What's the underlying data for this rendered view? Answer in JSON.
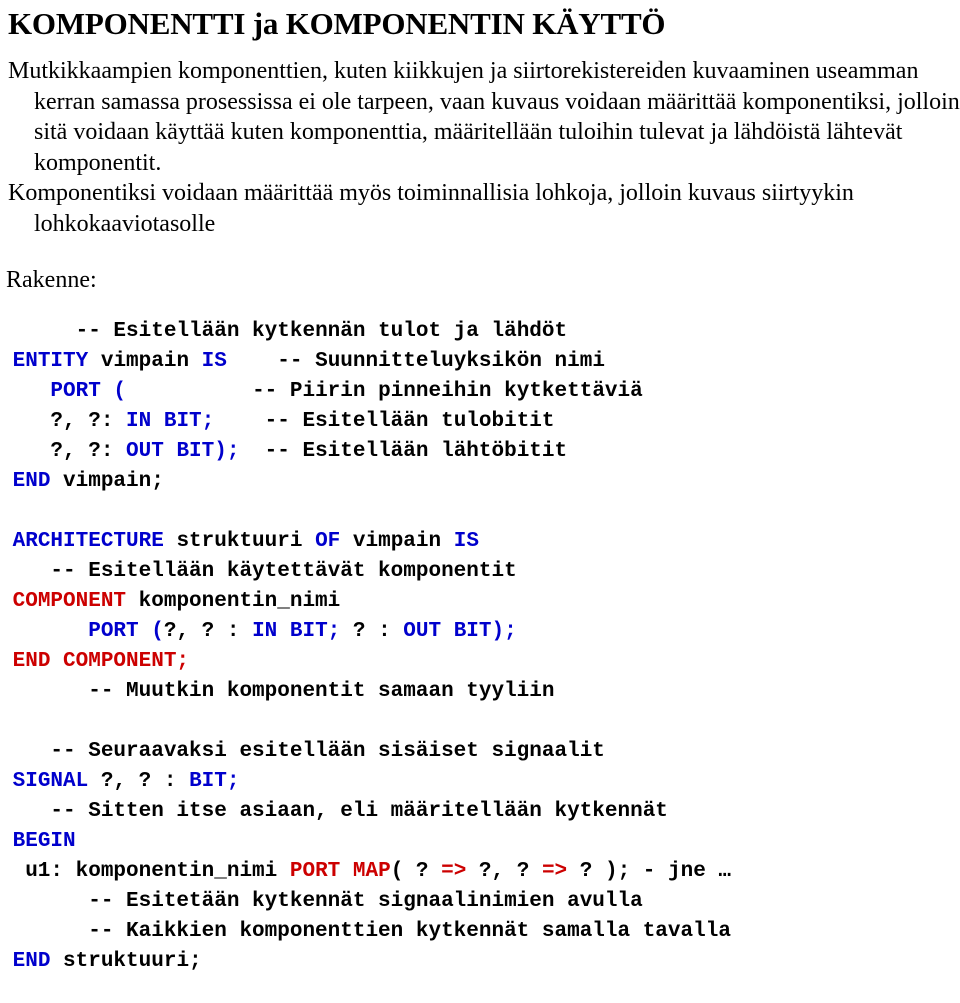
{
  "document": {
    "title": "KOMPONENTTI ja KOMPONENTIN KÄYTTÖ",
    "colors": {
      "keyword_blue": "#0000CC",
      "keyword_red": "#CC0000",
      "text_black": "#000000",
      "background": "#FFFFFF"
    },
    "paragraphs": [
      "Mutkikkaampien komponenttien, kuten kiikkujen ja siirtorekistereiden kuvaaminen useamman kerran samassa prosessissa ei ole tarpeen, vaan kuvaus voidaan määrittää komponentiksi, jolloin sitä voidaan käyttää kuten komponenttia, määritellään tuloihin tulevat ja lähdöistä lähtevät komponentit.",
      "Komponentiksi voidaan määrittää myös toiminnallisia lohkoja, jolloin kuvaus siirtyykin lohkokaaviotasolle"
    ],
    "section_label": "Rakenne:",
    "code": {
      "lines": [
        {
          "id": "code-line-1",
          "spans": [
            {
              "text": "      ",
              "color": "black"
            },
            {
              "text": "-- Esitellään kytkennän tulot ja lähdöt",
              "color": "black"
            }
          ]
        },
        {
          "id": "code-line-2",
          "spans": [
            {
              "text": " ",
              "color": "black"
            },
            {
              "text": "ENTITY",
              "color": "blue"
            },
            {
              "text": " vimpain ",
              "color": "black"
            },
            {
              "text": "IS",
              "color": "blue"
            },
            {
              "text": "    -- Suunnitteluyksikön nimi",
              "color": "black"
            }
          ]
        },
        {
          "id": "code-line-3",
          "spans": [
            {
              "text": "    ",
              "color": "black"
            },
            {
              "text": "PORT (",
              "color": "blue"
            },
            {
              "text": "          -- Piirin pinneihin kytkettäviä",
              "color": "black"
            }
          ]
        },
        {
          "id": "code-line-4",
          "spans": [
            {
              "text": "    ?, ?: ",
              "color": "black"
            },
            {
              "text": "IN BIT;",
              "color": "blue"
            },
            {
              "text": "    -- Esitellään tulobitit",
              "color": "black"
            }
          ]
        },
        {
          "id": "code-line-5",
          "spans": [
            {
              "text": "    ?, ?: ",
              "color": "black"
            },
            {
              "text": "OUT BIT);",
              "color": "blue"
            },
            {
              "text": "  -- Esitellään lähtöbitit",
              "color": "black"
            }
          ]
        },
        {
          "id": "code-line-6",
          "spans": [
            {
              "text": " ",
              "color": "black"
            },
            {
              "text": "END",
              "color": "blue"
            },
            {
              "text": " vimpain;",
              "color": "black"
            }
          ]
        },
        {
          "id": "code-line-7",
          "blank": true,
          "spans": []
        },
        {
          "id": "code-line-8",
          "spans": [
            {
              "text": " ",
              "color": "black"
            },
            {
              "text": "ARCHITECTURE",
              "color": "blue"
            },
            {
              "text": " struktuuri ",
              "color": "black"
            },
            {
              "text": "OF",
              "color": "blue"
            },
            {
              "text": " vimpain ",
              "color": "black"
            },
            {
              "text": "IS",
              "color": "blue"
            }
          ]
        },
        {
          "id": "code-line-9",
          "spans": [
            {
              "text": "    -- Esitellään käytettävät komponentit",
              "color": "black"
            }
          ]
        },
        {
          "id": "code-line-10",
          "spans": [
            {
              "text": " ",
              "color": "black"
            },
            {
              "text": "COMPONENT",
              "color": "red"
            },
            {
              "text": " komponentin_nimi",
              "color": "black"
            }
          ]
        },
        {
          "id": "code-line-11",
          "spans": [
            {
              "text": "       ",
              "color": "black"
            },
            {
              "text": "PORT (",
              "color": "blue"
            },
            {
              "text": "?, ? : ",
              "color": "black"
            },
            {
              "text": "IN BIT;",
              "color": "blue"
            },
            {
              "text": " ? : ",
              "color": "black"
            },
            {
              "text": "OUT BIT);",
              "color": "blue"
            }
          ]
        },
        {
          "id": "code-line-12",
          "spans": [
            {
              "text": " ",
              "color": "black"
            },
            {
              "text": "END COMPONENT;",
              "color": "red"
            }
          ]
        },
        {
          "id": "code-line-13",
          "spans": [
            {
              "text": "       -- Muutkin komponentit samaan tyyliin",
              "color": "black"
            }
          ]
        },
        {
          "id": "code-line-14",
          "blank": true,
          "spans": []
        },
        {
          "id": "code-line-15",
          "spans": [
            {
              "text": "    -- Seuraavaksi esitellään sisäiset signaalit",
              "color": "black"
            }
          ]
        },
        {
          "id": "code-line-16",
          "spans": [
            {
              "text": " ",
              "color": "black"
            },
            {
              "text": "SIGNAL",
              "color": "blue"
            },
            {
              "text": " ?, ? : ",
              "color": "black"
            },
            {
              "text": "BIT;",
              "color": "blue"
            }
          ]
        },
        {
          "id": "code-line-17",
          "spans": [
            {
              "text": "    -- Sitten itse asiaan, eli määritellään kytkennät",
              "color": "black"
            }
          ]
        },
        {
          "id": "code-line-18",
          "spans": [
            {
              "text": " ",
              "color": "black"
            },
            {
              "text": "BEGIN",
              "color": "blue"
            }
          ]
        },
        {
          "id": "code-line-19",
          "spans": [
            {
              "text": "  u1: komponentin_nimi ",
              "color": "black"
            },
            {
              "text": "PORT MAP",
              "color": "red"
            },
            {
              "text": "( ? ",
              "color": "black"
            },
            {
              "text": "=>",
              "color": "red"
            },
            {
              "text": " ?, ? ",
              "color": "black"
            },
            {
              "text": "=>",
              "color": "red"
            },
            {
              "text": " ? ); - jne …",
              "color": "black"
            }
          ]
        },
        {
          "id": "code-line-20",
          "spans": [
            {
              "text": "       -- Esitetään kytkennät signaalinimien avulla",
              "color": "black"
            }
          ]
        },
        {
          "id": "code-line-21",
          "spans": [
            {
              "text": "       -- Kaikkien komponenttien kytkennät samalla tavalla",
              "color": "black"
            }
          ]
        },
        {
          "id": "code-line-22",
          "spans": [
            {
              "text": " ",
              "color": "black"
            },
            {
              "text": "END",
              "color": "blue"
            },
            {
              "text": " struktuuri;",
              "color": "black"
            }
          ]
        }
      ]
    }
  }
}
